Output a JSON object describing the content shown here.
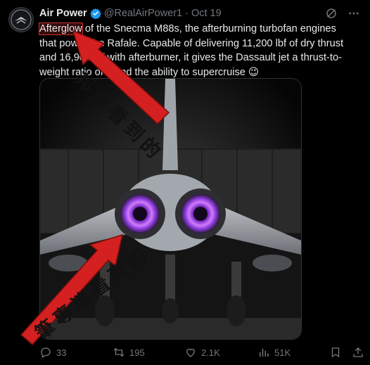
{
  "author": {
    "name": "Air Power",
    "handle": "@RealAirPower1",
    "separator": "·",
    "date": "Oct 19"
  },
  "tweet": {
    "text_highlight": "Afterglow",
    "text_rest": " of the Snecma M88s, the afterburning turbofan engines that power the Rafale. Capable of delivering 11,200 lbf of dry thrust and 16,900 lbf with afterburner, it gives the Dassault jet a thrust-to-weight ratio of 1 and the ability to supercruise",
    "emoji": "😉"
  },
  "annotations": {
    "top": "邦廚看到的",
    "bottom": "筆專迷看到的",
    "color": "#d42020"
  },
  "stats": {
    "replies": "33",
    "reposts": "195",
    "likes": "2.1K",
    "views": "51K"
  },
  "icons": [
    "verified-badge-icon",
    "grok-icon",
    "more-icon",
    "reply-icon",
    "repost-icon",
    "like-icon",
    "views-icon",
    "bookmark-icon",
    "share-icon"
  ],
  "colors": {
    "background": "#000000",
    "text": "#e7e9ea",
    "muted": "#71767b",
    "verified": "#1d9bf0",
    "afterburner": "#b04cff"
  }
}
